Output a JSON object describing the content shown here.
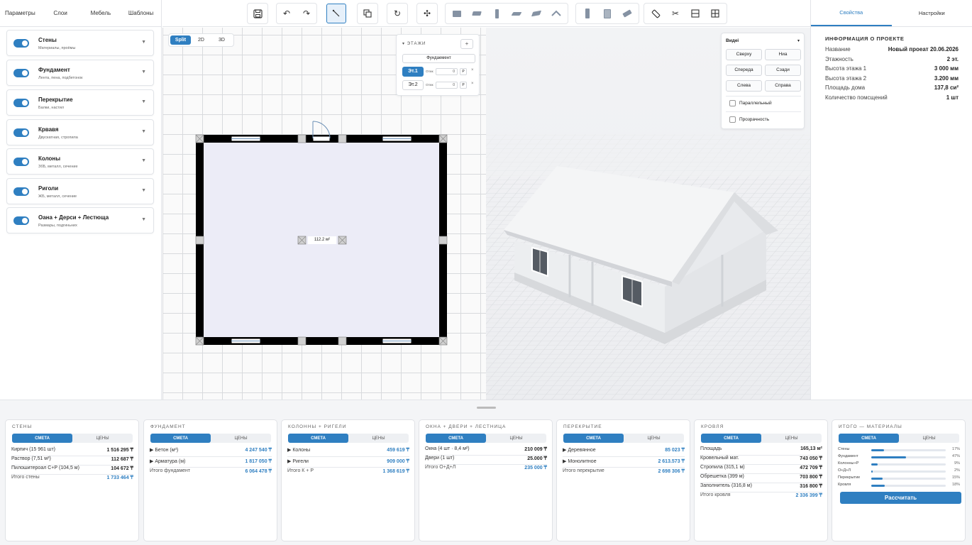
{
  "left_tabs": [
    "Параметры",
    "Слои",
    "Мебель",
    "Шаблоны"
  ],
  "layers": [
    {
      "name": "Стены",
      "sub": "Материалы, проёмы"
    },
    {
      "name": "Фундамент",
      "sub": "Лента, пена, подбетонок"
    },
    {
      "name": "Перекрытие",
      "sub": "Балки, настил"
    },
    {
      "name": "Крвавя",
      "sub": "Двускатная, стропила"
    },
    {
      "name": "Колоны",
      "sub": "ЗбБ, металл, сечение"
    },
    {
      "name": "Риголи",
      "sub": "ЖБ, металл, сечение"
    },
    {
      "name": "Оана + Дерси + Лестюща",
      "sub": "Размары, подгиньних"
    }
  ],
  "view_toggle": [
    "Split",
    "2D",
    "3D"
  ],
  "floors": {
    "title": "ЭТАЖИ",
    "plus": "+",
    "foundation": "Фундаемент",
    "rows": [
      {
        "label": "Эт.1",
        "field_label": "Отмк",
        "value": "0",
        "p": "P",
        "x": "×"
      },
      {
        "label": "Эт.2",
        "field_label": "Отмк",
        "value": "0",
        "p": "P",
        "x": "×"
      }
    ]
  },
  "plan": {
    "area_label": "112.2 м²"
  },
  "view_panel": {
    "title": "Видеі",
    "caret": "▾",
    "buttons": [
      "Сверху",
      "Ниа",
      "Спереда",
      "Сзади",
      "Слева",
      "Справа"
    ],
    "checkboxes": [
      "Параллельный",
      "Прозрачность"
    ]
  },
  "right_tabs": [
    "Свойства",
    "Настройки"
  ],
  "project": {
    "title": "ИНФОРМАЦИЯ О ПРОЕКТЕ",
    "rows": [
      {
        "k": "Название",
        "v": "Новый проеат 20.06.2026"
      },
      {
        "k": "Этажность",
        "v": "2 эт."
      },
      {
        "k": "Высота этажа 1",
        "v": "3 000 мм"
      },
      {
        "k": "Высота этажа 2",
        "v": "3.200 мм"
      },
      {
        "k": "Площадь дома",
        "v": "137,8 си²"
      },
      {
        "k": "Количество помсщений",
        "v": "1 шт"
      }
    ]
  },
  "cards": [
    {
      "title": "СТЕНЫ",
      "seg": [
        "СМЕТА",
        "ЦЕНЫ"
      ],
      "rows": [
        {
          "k": "Кирпич (15 961 шт)",
          "v": "1 516 295 ₸"
        },
        {
          "k": "Раствор (7,51 м³)",
          "v": "112 687 ₸"
        },
        {
          "k": "Пилошитероал С+Р (104,5 м)",
          "v": "104 672 ₸"
        }
      ],
      "total": {
        "k": "Итого стены",
        "v": "1 733 464 ₸"
      }
    },
    {
      "title": "ФУНДАМЕНТ",
      "seg": [
        "СМЕТА",
        "ЦЕНЫ"
      ],
      "rows": [
        {
          "k": "▶ Бетон (м³)",
          "v": "4 247 540 ₸"
        },
        {
          "k": "▶ Арматура (м)",
          "v": "1 817 050 ₸"
        }
      ],
      "total": {
        "k": "Итого фундамент",
        "v": "6 064 478 ₸"
      }
    },
    {
      "title": "КОЛОННЫ + РИГЕЛИ",
      "seg": [
        "СМЕТА",
        "ЦЕНЫ"
      ],
      "rows": [
        {
          "k": "▶ Колоны",
          "v": "459 619 ₸"
        },
        {
          "k": "▶ Ригели",
          "v": "909 000 ₸"
        }
      ],
      "total": {
        "k": "Итого К + Р",
        "v": "1 368 619 ₸"
      }
    },
    {
      "title": "ОКНА + ДВЕРИ + ЛЕСТНИЦА",
      "seg": [
        "СМЕТА",
        "ЦЕНЫ"
      ],
      "rows": [
        {
          "k": "Окна (4 шт · 8,4 м²)",
          "v": "210 009 ₸"
        },
        {
          "k": "Двери (1 шт)",
          "v": "25.000 ₸"
        }
      ],
      "total": {
        "k": "Итого О+Д+Л",
        "v": "235 000 ₸"
      }
    },
    {
      "title": "ПЕРЕКРЫТИЕ",
      "seg": [
        "СМЕТА",
        "ЦЕНЫ"
      ],
      "rows": [
        {
          "k": "▶ Деревянное",
          "v": "85 023 ₸"
        },
        {
          "k": "▶ Монолитное",
          "v": "2 613.573 ₸"
        }
      ],
      "total": {
        "k": "Итого перекрытие",
        "v": "2 698 306 ₸"
      }
    },
    {
      "title": "КРОВЛЯ",
      "seg": [
        "СМЕТА",
        "ЦЕНЫ"
      ],
      "rows": [
        {
          "k": "Площадь",
          "v": "165,13 м²"
        },
        {
          "k": "Кровельный мат.",
          "v": "743 050 ₸"
        },
        {
          "k": "Стропила (315,1 м)",
          "v": "472 709 ₸"
        },
        {
          "k": "Обрешетка (399 м)",
          "v": "703 800 ₸"
        },
        {
          "k": "Заполнитель (316,8 м)",
          "v": "316 800 ₸"
        }
      ],
      "total": {
        "k": "Итого кровля",
        "v": "2 336 399 ₸"
      }
    }
  ],
  "summary": {
    "title": "ИТОГО — МАТЕРИАЛЫ",
    "seg": [
      "СМЕТА",
      "ЦЕНЫ"
    ],
    "bars": [
      {
        "k": "Стены",
        "pct": "17%",
        "frac": 0.17
      },
      {
        "k": "Фундамент",
        "pct": "47%",
        "frac": 0.47
      },
      {
        "k": "Колонны+Р",
        "pct": "9%",
        "frac": 0.09
      },
      {
        "k": "О+Д+Л",
        "pct": "2%",
        "frac": 0.02
      },
      {
        "k": "Перекрытие",
        "pct": "15%",
        "frac": 0.15
      },
      {
        "k": "Кровля",
        "pct": "18%",
        "frac": 0.18
      }
    ],
    "calc": "Рассчитать"
  },
  "colors": {
    "accent": "#2f7fc1"
  }
}
